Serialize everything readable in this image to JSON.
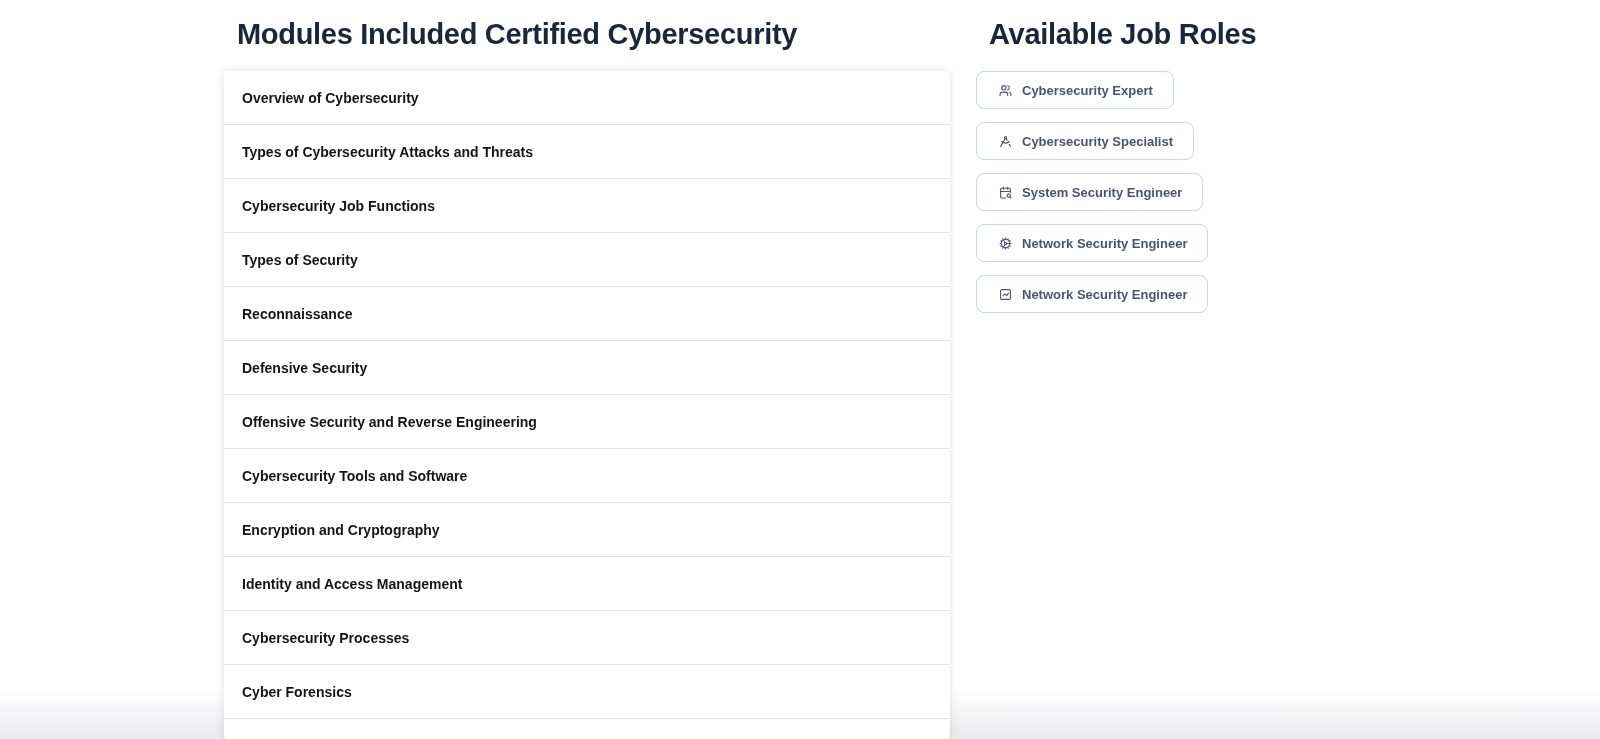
{
  "modules": {
    "title": "Modules Included Certified Cybersecurity",
    "items": [
      "Overview of Cybersecurity",
      "Types of Cybersecurity Attacks and Threats",
      "Cybersecurity Job Functions",
      "Types of Security",
      "Reconnaissance",
      "Defensive Security",
      "Offensive Security and Reverse Engineering",
      "Cybersecurity Tools and Software",
      "Encryption and Cryptography",
      "Identity and Access Management",
      "Cybersecurity Processes",
      "Cyber Forensics"
    ]
  },
  "job_roles": {
    "title": "Available Job Roles",
    "items": [
      "Cybersecurity Expert",
      "Cybersecurity Specialist",
      "System Security Engineer",
      "Network Security Engineer",
      "Network Security Engineer"
    ]
  }
}
